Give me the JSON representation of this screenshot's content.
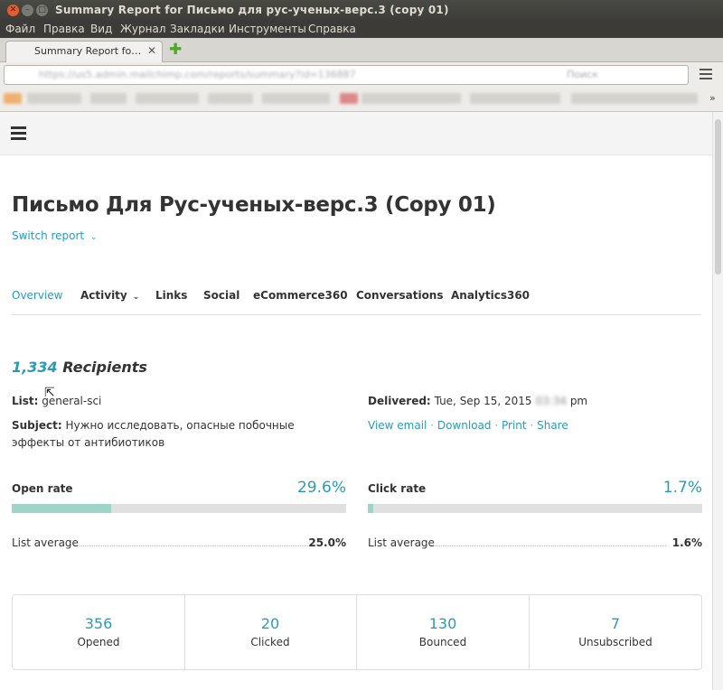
{
  "window": {
    "title": "Summary Report for Письмо для рус-ученых-верс.3 (copy 01)"
  },
  "menu": [
    "Файл",
    "Правка",
    "Вид",
    "Журнал",
    "Закладки",
    "Инструменты",
    "Справка"
  ],
  "browser": {
    "tab_label": "Summary Report fo…",
    "url": "https://us5.admin.mailchimp.com/reports/summary?id=136887",
    "search_placeholder": "Поиск"
  },
  "report": {
    "title": "Письмо Для Рус-ученых-верс.3 (Copy 01)",
    "switch_label": "Switch report",
    "tabs": [
      "Overview",
      "Activity",
      "Links",
      "Social",
      "eCommerce360",
      "Conversations",
      "Analytics360"
    ],
    "recipients_count": "1,334",
    "recipients_label": "Recipients",
    "list_label": "List:",
    "list_value": "general-sci",
    "subject_label": "Subject:",
    "subject_value": "Нужно исследовать, опасные побочные эффекты от антибиотиков",
    "delivered_label": "Delivered:",
    "delivered_value": "Tue, Sep 15, 2015",
    "delivered_time": "03:34",
    "delivered_suffix": "pm",
    "actions": [
      "View email",
      "Download",
      "Print",
      "Share"
    ],
    "open_rate": {
      "label": "Open rate",
      "value": "29.6%",
      "fraction": 0.296,
      "avg_label": "List average",
      "avg_value": "25.0%"
    },
    "click_rate": {
      "label": "Click rate",
      "value": "1.7%",
      "fraction": 0.017,
      "avg_label": "List average",
      "avg_value": "1.6%"
    },
    "stats": [
      {
        "value": "356",
        "label": "Opened"
      },
      {
        "value": "20",
        "label": "Clicked"
      },
      {
        "value": "130",
        "label": "Bounced"
      },
      {
        "value": "7",
        "label": "Unsubscribed"
      }
    ]
  },
  "colors": {
    "accent": "#2a9bb7",
    "bar_fill": "#9dd5c8",
    "bar_track": "#e0e0e0"
  }
}
